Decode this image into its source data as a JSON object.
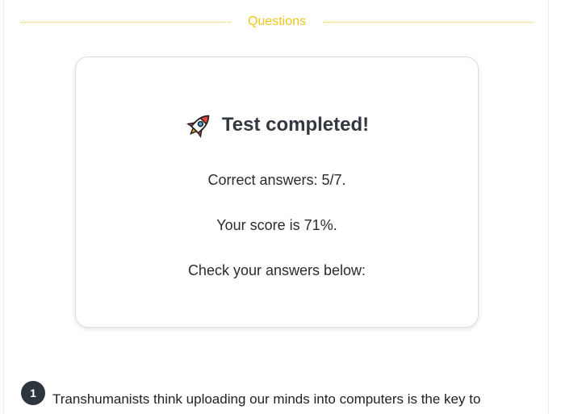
{
  "section": {
    "title": "Questions"
  },
  "result": {
    "title": "Test completed!",
    "icon": "rocket-icon",
    "correct_answers": "Correct answers: 5/7.",
    "score": "Your score is 71%.",
    "check_prompt": "Check your answers below:"
  },
  "questions": [
    {
      "number": "1",
      "text": "Transhumanists think uploading our minds into computers is the key to"
    }
  ],
  "colors": {
    "accent": "#efc61c",
    "badge": "#2f353f",
    "title": "#333841"
  }
}
